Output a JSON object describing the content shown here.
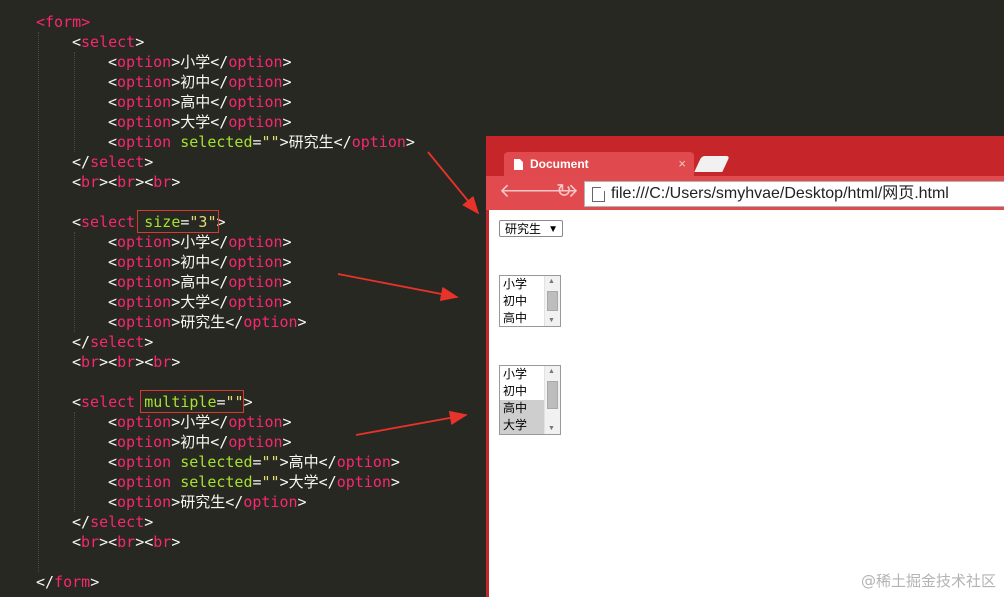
{
  "editor": {
    "lines": [
      [
        [
          "tag",
          "<form>"
        ]
      ],
      [
        [
          "pun",
          "<"
        ],
        [
          "tag",
          "select"
        ],
        [
          "pun",
          ">"
        ]
      ],
      [
        [
          "pun",
          "<"
        ],
        [
          "tag",
          "option"
        ],
        [
          "pun",
          ">"
        ],
        [
          "txt",
          "小学"
        ],
        [
          "pun",
          "</"
        ],
        [
          "tag",
          "option"
        ],
        [
          "pun",
          ">"
        ]
      ],
      [
        [
          "pun",
          "<"
        ],
        [
          "tag",
          "option"
        ],
        [
          "pun",
          ">"
        ],
        [
          "txt",
          "初中"
        ],
        [
          "pun",
          "</"
        ],
        [
          "tag",
          "option"
        ],
        [
          "pun",
          ">"
        ]
      ],
      [
        [
          "pun",
          "<"
        ],
        [
          "tag",
          "option"
        ],
        [
          "pun",
          ">"
        ],
        [
          "txt",
          "高中"
        ],
        [
          "pun",
          "</"
        ],
        [
          "tag",
          "option"
        ],
        [
          "pun",
          ">"
        ]
      ],
      [
        [
          "pun",
          "<"
        ],
        [
          "tag",
          "option"
        ],
        [
          "pun",
          ">"
        ],
        [
          "txt",
          "大学"
        ],
        [
          "pun",
          "</"
        ],
        [
          "tag",
          "option"
        ],
        [
          "pun",
          ">"
        ]
      ],
      [
        [
          "pun",
          "<"
        ],
        [
          "tag",
          "option"
        ],
        [
          "pun",
          " "
        ],
        [
          "attr",
          "selected"
        ],
        [
          "pun",
          "="
        ],
        [
          "str",
          "\"\""
        ],
        [
          "pun",
          ">"
        ],
        [
          "txt",
          "研究生"
        ],
        [
          "pun",
          "</"
        ],
        [
          "tag",
          "option"
        ],
        [
          "pun",
          ">"
        ]
      ],
      [
        [
          "pun",
          "</"
        ],
        [
          "tag",
          "select"
        ],
        [
          "pun",
          ">"
        ]
      ],
      [
        [
          "pun",
          "<"
        ],
        [
          "tag",
          "br"
        ],
        [
          "pun",
          "><"
        ],
        [
          "tag",
          "br"
        ],
        [
          "pun",
          "><"
        ],
        [
          "tag",
          "br"
        ],
        [
          "pun",
          ">"
        ]
      ],
      [],
      [
        [
          "pun",
          "<"
        ],
        [
          "tag",
          "select"
        ],
        [
          "pun",
          " "
        ],
        [
          "attr",
          "size"
        ],
        [
          "pun",
          "="
        ],
        [
          "str",
          "\"3\""
        ],
        [
          "pun",
          ">"
        ]
      ],
      [
        [
          "pun",
          "<"
        ],
        [
          "tag",
          "option"
        ],
        [
          "pun",
          ">"
        ],
        [
          "txt",
          "小学"
        ],
        [
          "pun",
          "</"
        ],
        [
          "tag",
          "option"
        ],
        [
          "pun",
          ">"
        ]
      ],
      [
        [
          "pun",
          "<"
        ],
        [
          "tag",
          "option"
        ],
        [
          "pun",
          ">"
        ],
        [
          "txt",
          "初中"
        ],
        [
          "pun",
          "</"
        ],
        [
          "tag",
          "option"
        ],
        [
          "pun",
          ">"
        ]
      ],
      [
        [
          "pun",
          "<"
        ],
        [
          "tag",
          "option"
        ],
        [
          "pun",
          ">"
        ],
        [
          "txt",
          "高中"
        ],
        [
          "pun",
          "</"
        ],
        [
          "tag",
          "option"
        ],
        [
          "pun",
          ">"
        ]
      ],
      [
        [
          "pun",
          "<"
        ],
        [
          "tag",
          "option"
        ],
        [
          "pun",
          ">"
        ],
        [
          "txt",
          "大学"
        ],
        [
          "pun",
          "</"
        ],
        [
          "tag",
          "option"
        ],
        [
          "pun",
          ">"
        ]
      ],
      [
        [
          "pun",
          "<"
        ],
        [
          "tag",
          "option"
        ],
        [
          "pun",
          ">"
        ],
        [
          "txt",
          "研究生"
        ],
        [
          "pun",
          "</"
        ],
        [
          "tag",
          "option"
        ],
        [
          "pun",
          ">"
        ]
      ],
      [
        [
          "pun",
          "</"
        ],
        [
          "tag",
          "select"
        ],
        [
          "pun",
          ">"
        ]
      ],
      [
        [
          "pun",
          "<"
        ],
        [
          "tag",
          "br"
        ],
        [
          "pun",
          "><"
        ],
        [
          "tag",
          "br"
        ],
        [
          "pun",
          "><"
        ],
        [
          "tag",
          "br"
        ],
        [
          "pun",
          ">"
        ]
      ],
      [],
      [
        [
          "pun",
          "<"
        ],
        [
          "tag",
          "select"
        ],
        [
          "pun",
          " "
        ],
        [
          "attr",
          "multiple"
        ],
        [
          "pun",
          "="
        ],
        [
          "str",
          "\"\""
        ],
        [
          "pun",
          ">"
        ]
      ],
      [
        [
          "pun",
          "<"
        ],
        [
          "tag",
          "option"
        ],
        [
          "pun",
          ">"
        ],
        [
          "txt",
          "小学"
        ],
        [
          "pun",
          "</"
        ],
        [
          "tag",
          "option"
        ],
        [
          "pun",
          ">"
        ]
      ],
      [
        [
          "pun",
          "<"
        ],
        [
          "tag",
          "option"
        ],
        [
          "pun",
          ">"
        ],
        [
          "txt",
          "初中"
        ],
        [
          "pun",
          "</"
        ],
        [
          "tag",
          "option"
        ],
        [
          "pun",
          ">"
        ]
      ],
      [
        [
          "pun",
          "<"
        ],
        [
          "tag",
          "option"
        ],
        [
          "pun",
          " "
        ],
        [
          "attr",
          "selected"
        ],
        [
          "pun",
          "="
        ],
        [
          "str",
          "\"\""
        ],
        [
          "pun",
          ">"
        ],
        [
          "txt",
          "高中"
        ],
        [
          "pun",
          "</"
        ],
        [
          "tag",
          "option"
        ],
        [
          "pun",
          ">"
        ]
      ],
      [
        [
          "pun",
          "<"
        ],
        [
          "tag",
          "option"
        ],
        [
          "pun",
          " "
        ],
        [
          "attr",
          "selected"
        ],
        [
          "pun",
          "="
        ],
        [
          "str",
          "\"\""
        ],
        [
          "pun",
          ">"
        ],
        [
          "txt",
          "大学"
        ],
        [
          "pun",
          "</"
        ],
        [
          "tag",
          "option"
        ],
        [
          "pun",
          ">"
        ]
      ],
      [
        [
          "pun",
          "<"
        ],
        [
          "tag",
          "option"
        ],
        [
          "pun",
          ">"
        ],
        [
          "txt",
          "研究生"
        ],
        [
          "pun",
          "</"
        ],
        [
          "tag",
          "option"
        ],
        [
          "pun",
          ">"
        ]
      ],
      [
        [
          "pun",
          "</"
        ],
        [
          "tag",
          "select"
        ],
        [
          "pun",
          ">"
        ]
      ],
      [
        [
          "pun",
          "<"
        ],
        [
          "tag",
          "br"
        ],
        [
          "pun",
          "><"
        ],
        [
          "tag",
          "br"
        ],
        [
          "pun",
          "><"
        ],
        [
          "tag",
          "br"
        ],
        [
          "pun",
          ">"
        ]
      ],
      [],
      [
        [
          "pun",
          "</"
        ],
        [
          "tag",
          "form"
        ],
        [
          "pun",
          ">"
        ]
      ]
    ],
    "colors": {
      "background": "#272822",
      "tag": "#f92672",
      "attribute": "#a6e22e",
      "string": "#e6db74",
      "text": "#f8f8f2",
      "highlight_box": "#d83a2e",
      "arrow": "#e8322a"
    }
  },
  "browser": {
    "tab_title": "Document",
    "tab_close": "×",
    "back_icon": "arrow-left-icon",
    "forward_icon": "arrow-right-icon",
    "reload_icon": "reload-icon",
    "back_glyph": "🡐",
    "forward_glyph": "🡒",
    "reload_glyph": "↻",
    "url": "file:///C:/Users/smyhvae/Desktop/html/网页.html",
    "chrome_color": "#c6262a"
  },
  "page": {
    "dropdown": {
      "selected": "研究生",
      "arrow": "▼"
    },
    "listbox_size3": {
      "options": [
        "小学",
        "初中",
        "高中"
      ]
    },
    "listbox_multiple": {
      "options": [
        "小学",
        "初中",
        "高中",
        "大学"
      ],
      "selected": [
        "高中",
        "大学"
      ]
    },
    "scroll_up": "▲",
    "scroll_down": "▼"
  },
  "watermark": "@稀土掘金技术社区"
}
